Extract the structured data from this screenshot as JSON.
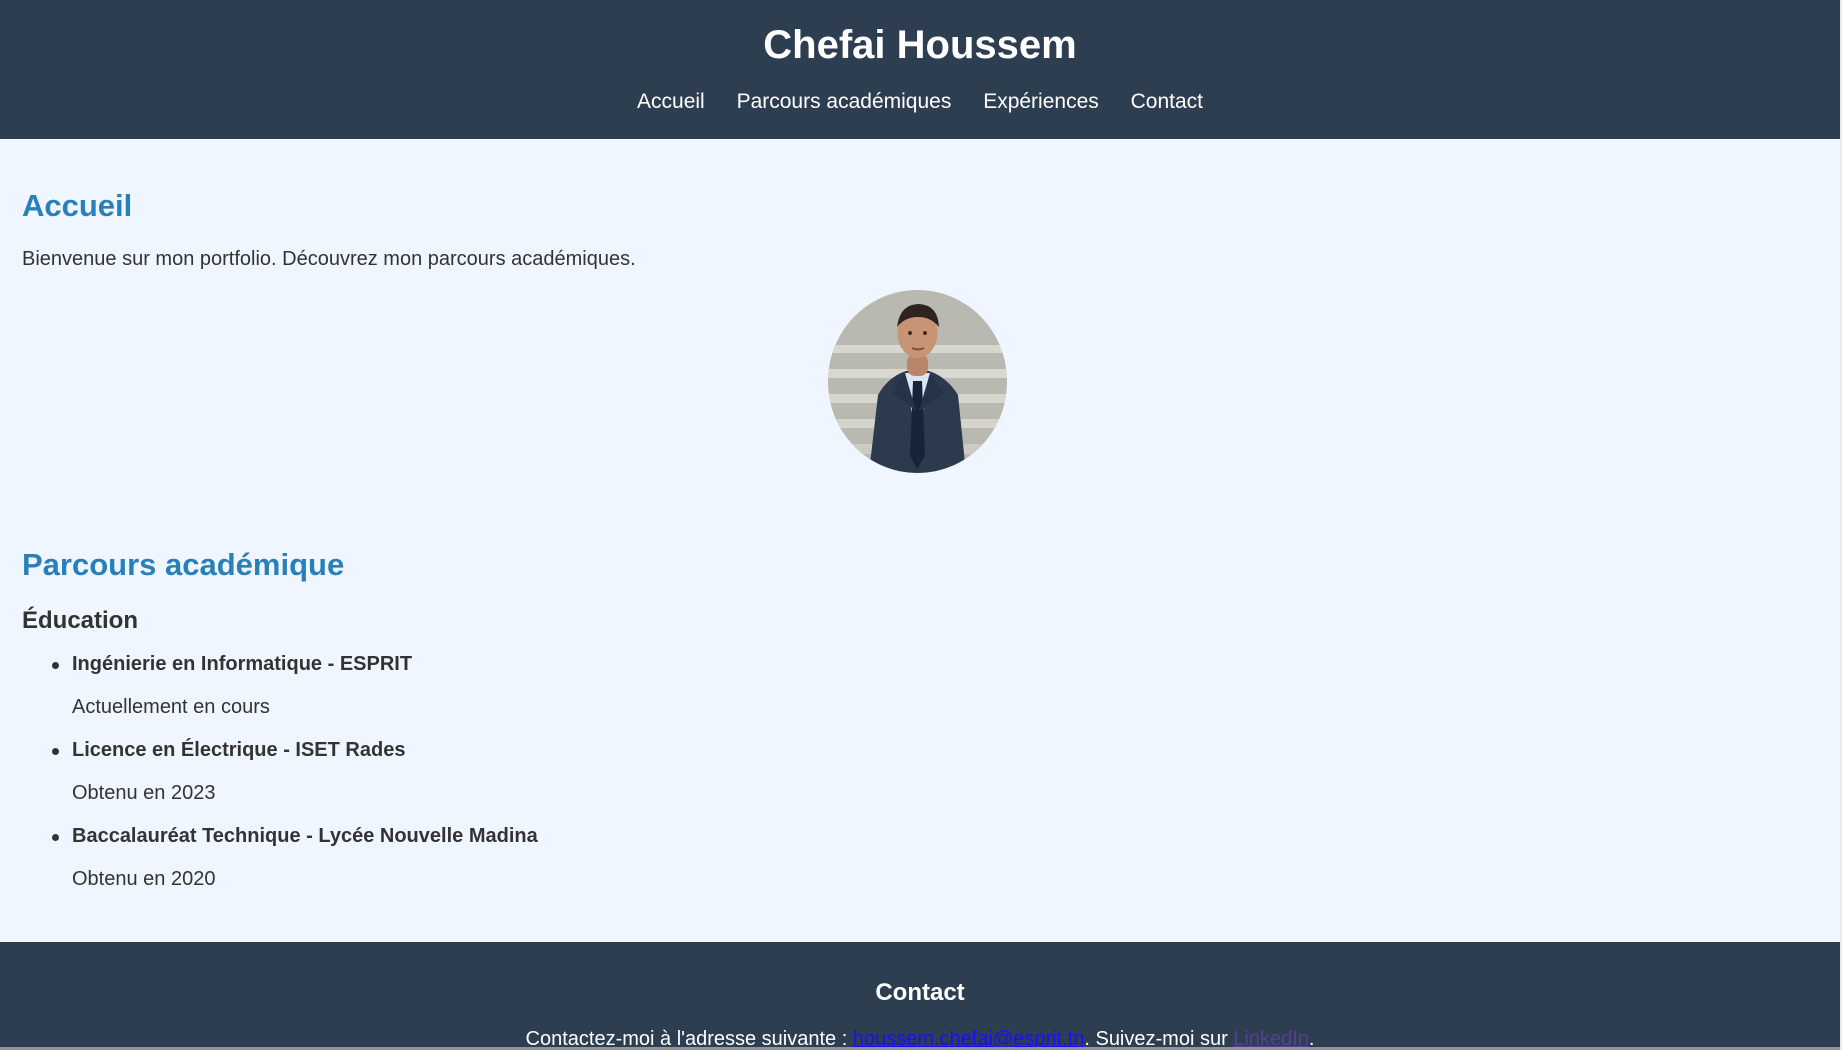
{
  "header": {
    "title": "Chefai Houssem",
    "nav": [
      {
        "label": "Accueil"
      },
      {
        "label": "Parcours académiques"
      },
      {
        "label": "Expériences"
      },
      {
        "label": "Contact"
      }
    ]
  },
  "home": {
    "heading": "Accueil",
    "intro": "Bienvenue sur mon portfolio. Découvrez mon parcours académiques."
  },
  "academic": {
    "heading": "Parcours académique",
    "education_heading": "Éducation",
    "items": [
      {
        "title": "Ingénierie en Informatique - ESPRIT",
        "detail": "Actuellement en cours"
      },
      {
        "title": "Licence en Électrique - ISET Rades",
        "detail": "Obtenu en 2023"
      },
      {
        "title": "Baccalauréat Technique - Lycée Nouvelle Madina",
        "detail": "Obtenu en 2020"
      }
    ]
  },
  "footer": {
    "heading": "Contact",
    "text_before": "Contactez-moi à l'adresse suivante : ",
    "email": "houssem.chefai@esprit.tn",
    "text_middle": ". Suivez-moi sur ",
    "linkedin": "LinkedIn",
    "text_after": "."
  },
  "colors": {
    "header_bg": "#2c3e50",
    "page_bg": "#f0f6ff",
    "accent": "#2980b9"
  }
}
